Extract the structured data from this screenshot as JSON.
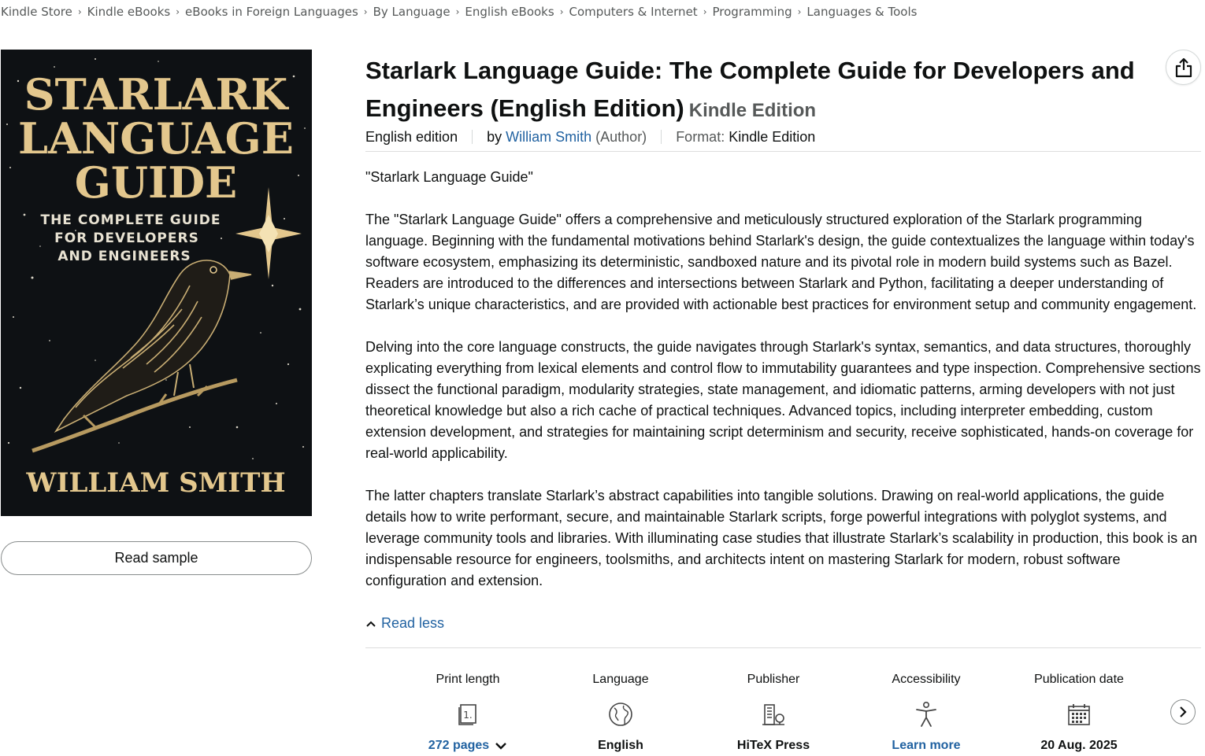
{
  "breadcrumb": [
    "Kindle Store",
    "Kindle eBooks",
    "eBooks in Foreign Languages",
    "By Language",
    "English eBooks",
    "Computers & Internet",
    "Programming",
    "Languages & Tools"
  ],
  "cover": {
    "title_lines": [
      "STARLARK",
      "LANGUAGE",
      "GUIDE"
    ],
    "subtitle_lines": [
      "THE COMPLETE GUIDE",
      "FOR DEVELOPERS",
      "AND ENGINEERS"
    ],
    "author": "WILLIAM SMITH"
  },
  "read_sample": "Read sample",
  "product": {
    "title": "Starlark Language Guide: The Complete Guide for Developers and Engineers (English Edition)",
    "edition_badge": "Kindle Edition",
    "edition": "English edition",
    "by_prefix": "by",
    "author": "William Smith",
    "author_role": "(Author)",
    "format_label": "Format:",
    "format_value": "Kindle Edition"
  },
  "share_icon": "share-icon",
  "description": {
    "paragraphs": [
      "\"Starlark Language Guide\"",
      "The \"Starlark Language Guide\" offers a comprehensive and meticulously structured exploration of the Starlark programming language. Beginning with the fundamental motivations behind Starlark's design, the guide contextualizes the language within today's software ecosystem, emphasizing its deterministic, sandboxed nature and its pivotal role in modern build systems such as Bazel. Readers are introduced to the differences and intersections between Starlark and Python, facilitating a deeper understanding of Starlark’s unique characteristics, and are provided with actionable best practices for environment setup and community engagement.",
      "Delving into the core language constructs, the guide navigates through Starlark's syntax, semantics, and data structures, thoroughly explicating everything from lexical elements and control flow to immutability guarantees and type inspection. Comprehensive sections dissect the functional paradigm, modularity strategies, state management, and idiomatic patterns, arming developers with not just theoretical knowledge but also a rich cache of practical techniques. Advanced topics, including interpreter embedding, custom extension development, and strategies for maintaining script determinism and security, receive sophisticated, hands-on coverage for real-world applicability.",
      "The latter chapters translate Starlark’s abstract capabilities into tangible solutions. Drawing on real-world applications, the guide details how to write performant, secure, and maintainable Starlark scripts, forge powerful integrations with polyglot systems, and leverage community tools and libraries. With illuminating case studies that illustrate Starlark’s scalability in production, this book is an indispensable resource for engineers, toolsmiths, and architects intent on mastering Starlark for modern, robust software configuration and extension."
    ],
    "read_less": "Read less"
  },
  "details": [
    {
      "label": "Print length",
      "value": "272 pages",
      "icon": "book-pages-icon",
      "link": true
    },
    {
      "label": "Language",
      "value": "English",
      "icon": "globe-icon",
      "link": false
    },
    {
      "label": "Publisher",
      "value": "HiTeX Press",
      "icon": "building-icon",
      "link": false
    },
    {
      "label": "Accessibility",
      "value": "Learn more",
      "icon": "accessibility-icon",
      "link": true
    },
    {
      "label": "Publication date",
      "value": "20 Aug. 2025",
      "icon": "calendar-icon",
      "link": false
    }
  ],
  "colors": {
    "link": "#2162a1",
    "text": "#0f1111",
    "muted": "#565959",
    "cover_bg": "#0e1114",
    "cover_gold": "#e3c78d"
  }
}
